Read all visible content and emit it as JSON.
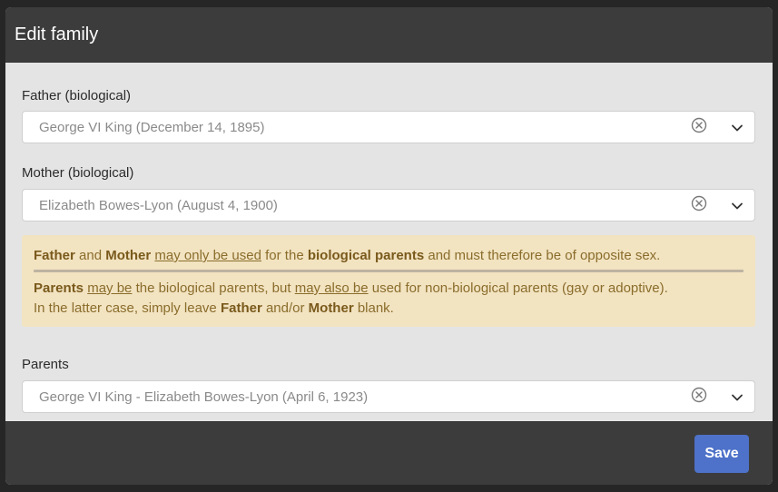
{
  "modal": {
    "title": "Edit family",
    "save_label": "Save"
  },
  "fields": {
    "father": {
      "label": "Father (biological)",
      "value": "George VI King (December 14, 1895)"
    },
    "mother": {
      "label": "Mother (biological)",
      "value": "Elizabeth Bowes-Lyon (August 4, 1900)"
    },
    "parents": {
      "label": "Parents",
      "value": "George VI King - Elizabeth Bowes-Lyon (April 6, 1923)"
    }
  },
  "notice": {
    "line1": {
      "father": "Father",
      "and": " and ",
      "mother": "Mother",
      "space1": " ",
      "may_only": "may only be used",
      "for_the": " for the ",
      "bio_parents": "biological parents",
      "rest": " and must therefore be of opposite sex."
    },
    "line2": {
      "parents": "Parents",
      "space1": " ",
      "may_be": "may be",
      "mid": " the biological parents, but ",
      "may_also_be": "may also be",
      "rest": " used for non-biological parents (gay or adoptive)."
    },
    "line3": {
      "start": "In the latter case, simply leave ",
      "father": "Father",
      "andor": " and/or ",
      "mother": "Mother",
      "end": " blank."
    }
  },
  "icons": {
    "clear": "clear-circle-icon",
    "chevron": "chevron-down-icon"
  },
  "colors": {
    "header": "#3c3c3c",
    "body": "#e4e4e4",
    "notice_bg": "#f2e3c1",
    "notice_text": "#8a6d2c",
    "save_button": "#4e72c9"
  }
}
